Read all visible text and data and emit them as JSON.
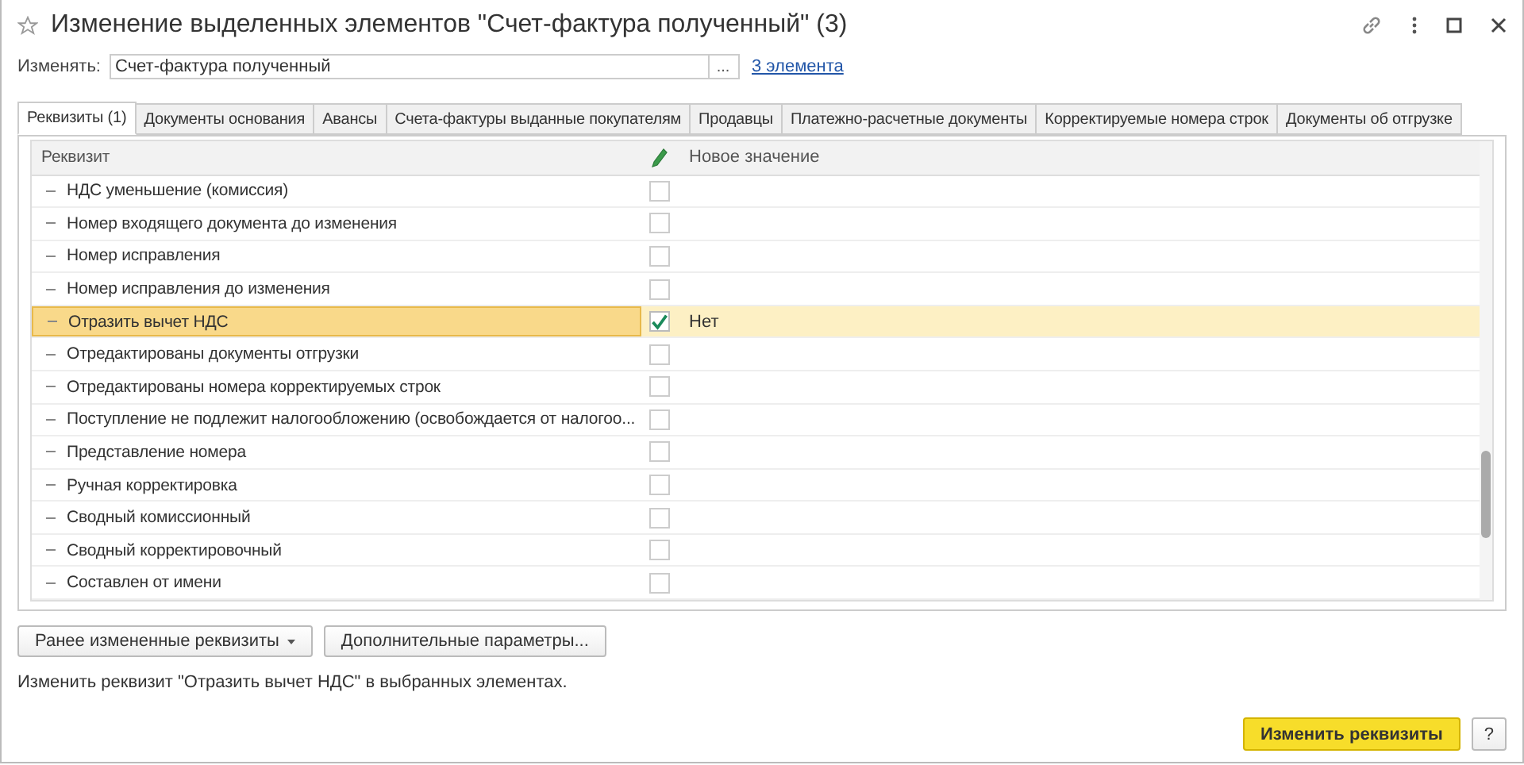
{
  "window": {
    "title": "Изменение выделенных элементов \"Счет-фактура полученный\" (3)"
  },
  "change_field": {
    "label": "Изменять:",
    "value": "Счет-фактура полученный",
    "select_button": "...",
    "link": "3 элемента"
  },
  "tabs": [
    {
      "label": "Реквизиты (1)",
      "selected": true
    },
    {
      "label": "Документы основания",
      "selected": false
    },
    {
      "label": "Авансы",
      "selected": false
    },
    {
      "label": "Счета-фактуры выданные покупателям",
      "selected": false
    },
    {
      "label": "Продавцы",
      "selected": false
    },
    {
      "label": "Платежно-расчетные документы",
      "selected": false
    },
    {
      "label": "Корректируемые номера строк",
      "selected": false
    },
    {
      "label": "Документы об отгрузке",
      "selected": false
    }
  ],
  "table": {
    "columns": [
      "Реквизит",
      "Новое значение"
    ],
    "rows": [
      {
        "name": "НДС уменьшение (комиссия)",
        "checked": false,
        "selected": false
      },
      {
        "name": "Номер входящего документа до изменения",
        "checked": false,
        "selected": false
      },
      {
        "name": "Номер исправления",
        "checked": false,
        "selected": false
      },
      {
        "name": "Номер исправления до изменения",
        "checked": false,
        "selected": false
      },
      {
        "name": "Отразить вычет НДС",
        "checked": true,
        "selected": true,
        "value": "Нет"
      },
      {
        "name": "Отредактированы документы отгрузки",
        "checked": false,
        "selected": false
      },
      {
        "name": "Отредактированы номера корректируемых строк",
        "checked": false,
        "selected": false
      },
      {
        "name": "Поступление не подлежит налогообложению (освобождается от налогоо...",
        "checked": false,
        "selected": false
      },
      {
        "name": "Представление номера",
        "checked": false,
        "selected": false
      },
      {
        "name": "Ручная корректировка",
        "checked": false,
        "selected": false
      },
      {
        "name": "Сводный комиссионный",
        "checked": false,
        "selected": false
      },
      {
        "name": "Сводный корректировочный",
        "checked": false,
        "selected": false
      },
      {
        "name": "Составлен от имени",
        "checked": false,
        "selected": false
      }
    ]
  },
  "buttons": [
    "Ранее измененные реквизиты",
    "Дополнительные параметры..."
  ],
  "status_text": "Изменить реквизит \"Отразить вычет НДС\" в выбранных элементах.",
  "footer_buttons": [
    {
      "label": "Изменить реквизиты",
      "kind": "primary"
    },
    {
      "label": "?",
      "kind": "plain"
    }
  ]
}
